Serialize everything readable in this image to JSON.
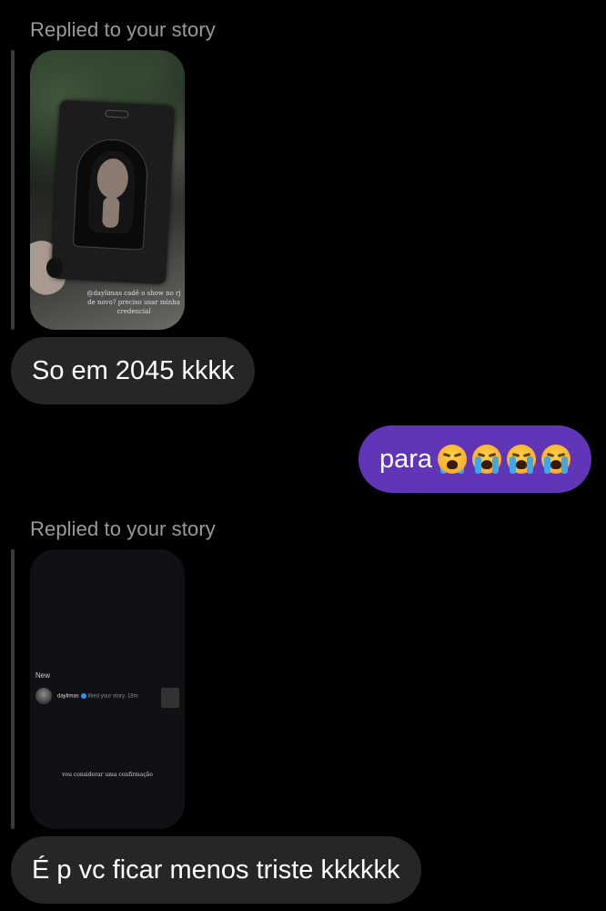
{
  "thread": {
    "messages": [
      {
        "type": "story_reply",
        "direction": "received",
        "reply_label": "Replied to your story",
        "story": {
          "caption": "@daylimas cadê o show no rj de novo? preciso usar minha credencial"
        },
        "text": "So em 2045 kkkk"
      },
      {
        "type": "text",
        "direction": "sent",
        "text": "para",
        "emojis": [
          "loudly-crying-face-icon",
          "loudly-crying-face-icon",
          "loudly-crying-face-icon",
          "loudly-crying-face-icon"
        ]
      },
      {
        "type": "story_reply",
        "direction": "received",
        "reply_label": "Replied to your story",
        "story": {
          "section_label": "New",
          "notification_user": "daylimas",
          "notification_action": "liked your story.",
          "notification_time": "18m",
          "bottom_text": "vou considerar uma confirmação"
        },
        "text": "É p vc ficar menos triste kkkkkk"
      }
    ]
  },
  "colors": {
    "background": "#000000",
    "received_bubble": "#262626",
    "sent_bubble": "#6135b8",
    "reply_label": "#9a9a9a",
    "reply_bar": "#3a3a3a"
  }
}
